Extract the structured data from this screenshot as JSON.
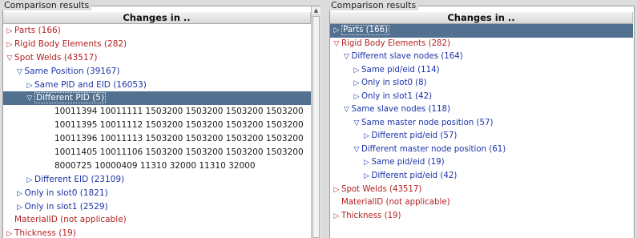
{
  "left": {
    "group_title": "Comparison results",
    "header": "Changes in ..",
    "rows": [
      {
        "indent": 0,
        "icon": "right",
        "label": "Parts (166)",
        "color": "red"
      },
      {
        "indent": 0,
        "icon": "right",
        "label": "Rigid Body Elements (282)",
        "color": "red"
      },
      {
        "indent": 0,
        "icon": "down",
        "label": "Spot Welds (43517)",
        "color": "red"
      },
      {
        "indent": 1,
        "icon": "down",
        "label": "Same Position (39167)",
        "color": "blue"
      },
      {
        "indent": 2,
        "icon": "right",
        "label": "Same PID and EID (16053)",
        "color": "blue"
      },
      {
        "indent": 2,
        "icon": "down",
        "label": "Different PID (5)",
        "color": "blue",
        "selected": true
      },
      {
        "indent": 4,
        "icon": "",
        "label": "10011394 10011111 1503200 1503200 1503200 1503200",
        "color": "black"
      },
      {
        "indent": 4,
        "icon": "",
        "label": "10011395 10011112 1503200 1503200 1503200 1503200",
        "color": "black"
      },
      {
        "indent": 4,
        "icon": "",
        "label": "10011396 10011113 1503200 1503200 1503200 1503200",
        "color": "black"
      },
      {
        "indent": 4,
        "icon": "",
        "label": "10011405 10011106 1503200 1503200 1503200 1503200",
        "color": "black"
      },
      {
        "indent": 4,
        "icon": "",
        "label": "8000725 10000409 11310 32000 11310 32000",
        "color": "black"
      },
      {
        "indent": 2,
        "icon": "right",
        "label": "Different EID (23109)",
        "color": "blue"
      },
      {
        "indent": 1,
        "icon": "right",
        "label": "Only in slot0 (1821)",
        "color": "blue"
      },
      {
        "indent": 1,
        "icon": "right",
        "label": "Only in slot1 (2529)",
        "color": "blue"
      },
      {
        "indent": 0,
        "icon": "",
        "label": "MaterialID (not applicable)",
        "color": "red"
      },
      {
        "indent": 0,
        "icon": "right",
        "label": "Thickness (19)",
        "color": "red"
      }
    ]
  },
  "right": {
    "group_title": "Comparison results",
    "header": "Changes in ..",
    "rows": [
      {
        "indent": 0,
        "icon": "right",
        "label": "Parts (166)",
        "color": "red",
        "selected": true
      },
      {
        "indent": 0,
        "icon": "down",
        "label": "Rigid Body Elements (282)",
        "color": "red"
      },
      {
        "indent": 1,
        "icon": "down",
        "label": "Different slave nodes (164)",
        "color": "blue"
      },
      {
        "indent": 2,
        "icon": "right",
        "label": "Same pid/eid (114)",
        "color": "blue"
      },
      {
        "indent": 2,
        "icon": "right",
        "label": "Only in slot0 (8)",
        "color": "blue"
      },
      {
        "indent": 2,
        "icon": "right",
        "label": "Only in slot1 (42)",
        "color": "blue"
      },
      {
        "indent": 1,
        "icon": "down",
        "label": "Same slave nodes (118)",
        "color": "blue"
      },
      {
        "indent": 2,
        "icon": "down",
        "label": "Same master node position (57)",
        "color": "blue"
      },
      {
        "indent": 3,
        "icon": "right",
        "label": "Different pid/eid (57)",
        "color": "blue"
      },
      {
        "indent": 2,
        "icon": "down",
        "label": "Different master node position (61)",
        "color": "blue"
      },
      {
        "indent": 3,
        "icon": "right",
        "label": "Same pid/eid (19)",
        "color": "blue"
      },
      {
        "indent": 3,
        "icon": "right",
        "label": "Different pid/eid (42)",
        "color": "blue"
      },
      {
        "indent": 0,
        "icon": "right",
        "label": "Spot Welds (43517)",
        "color": "red"
      },
      {
        "indent": 0,
        "icon": "",
        "label": "MaterialID (not applicable)",
        "color": "red"
      },
      {
        "indent": 0,
        "icon": "right",
        "label": "Thickness (19)",
        "color": "red"
      }
    ]
  },
  "glyphs": {
    "right": "▷",
    "down": "▽"
  }
}
